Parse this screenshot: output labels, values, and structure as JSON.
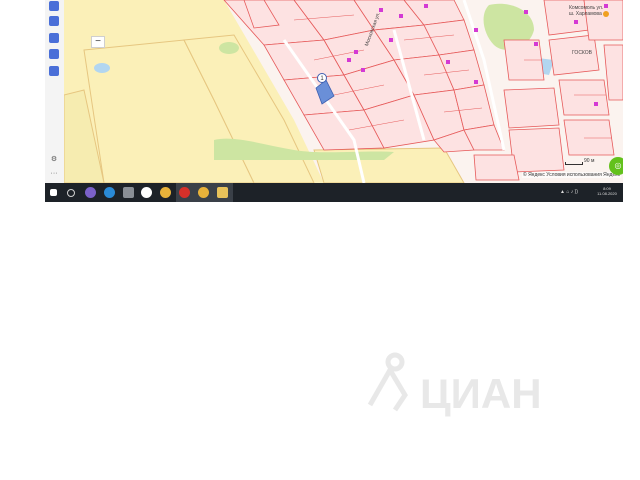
{
  "map": {
    "labels": {
      "top_right": "Комсомоль ул.\nш. Харламова",
      "right_mid": "ГОСКОВ",
      "road": "Московская ул."
    },
    "marker_number": "1",
    "zoom_out": "−",
    "scale_label": "90 м",
    "copyright": "© Яндекс Условия использования Яндекс",
    "locate_icon": "locate-icon",
    "colors": {
      "fields": "#fbf0b8",
      "parcels": "#e65a5a",
      "green": "#cde5a2",
      "water": "#b2d6f0",
      "marker": "#6a8fd8"
    }
  },
  "sidebar": {
    "icons": [
      "layers-icon",
      "navigation-icon",
      "traffic-icon",
      "ruler-icon",
      "print-icon",
      "settings-icon",
      "more-icon"
    ],
    "more_label": "···"
  },
  "taskbar": {
    "time": "8:09",
    "date": "11.08.2020",
    "apps": [
      "windows-start-icon",
      "search-icon",
      "viber-icon",
      "edge-icon",
      "photos-icon",
      "yandex-browser-icon",
      "chrome-icon",
      "opera-icon",
      "chrome-active-icon",
      "file-explorer-icon"
    ],
    "tray": "▲ ⌂ ♪ ))"
  },
  "watermark": {
    "text": "ЦИАН"
  }
}
